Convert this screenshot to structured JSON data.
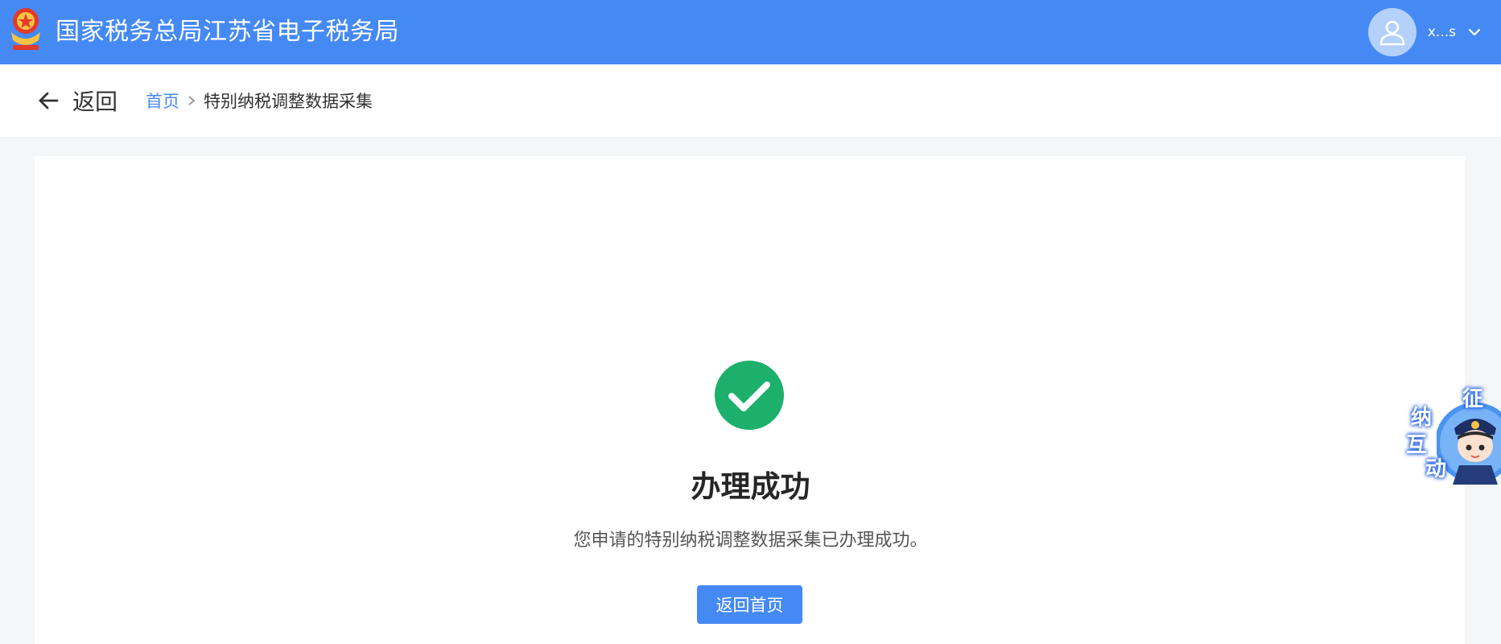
{
  "header": {
    "site_title": "国家税务总局江苏省电子税务局",
    "logo_icon": "tax-emblem-icon",
    "user": {
      "name": "x...s",
      "avatar_icon": "user-avatar-icon",
      "dropdown_icon": "chevron-down-icon"
    }
  },
  "navbar": {
    "back_label": "返回",
    "back_icon": "arrow-left-icon",
    "breadcrumb": {
      "home": "首页",
      "separator_icon": "chevron-right-icon",
      "current": "特别纳税调整数据采集"
    }
  },
  "result": {
    "status_icon": "check-circle-icon",
    "title": "办理成功",
    "description": "您申请的特别纳税调整数据采集已办理成功。",
    "button_label": "返回首页"
  },
  "assistant": {
    "chars": [
      "征",
      "纳",
      "互",
      "动"
    ],
    "icon": "tax-officer-mascot-icon"
  },
  "colors": {
    "primary": "#4589f5",
    "success": "#1db06c",
    "page_bg": "#f5f6f8"
  }
}
